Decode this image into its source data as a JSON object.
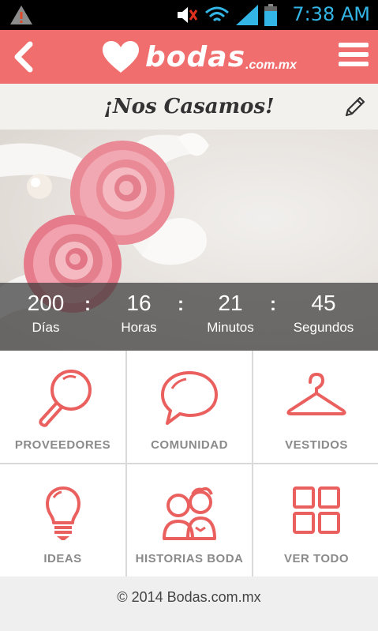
{
  "status": {
    "time": "7:38 AM"
  },
  "header": {
    "brand_name": "bodas",
    "brand_domain": ".com.mx"
  },
  "titlebar": {
    "title": "¡Nos Casamos!"
  },
  "countdown": [
    {
      "value": "200",
      "label": "Días"
    },
    {
      "value": "16",
      "label": "Horas"
    },
    {
      "value": "21",
      "label": "Minutos"
    },
    {
      "value": "45",
      "label": "Segundos"
    }
  ],
  "separator": ":",
  "tiles": [
    {
      "label": "PROVEEDORES",
      "icon": "search-icon"
    },
    {
      "label": "COMUNIDAD",
      "icon": "chat-bubble-icon"
    },
    {
      "label": "VESTIDOS",
      "icon": "hanger-icon"
    },
    {
      "label": "IDEAS",
      "icon": "lightbulb-icon"
    },
    {
      "label": "HISTORIAS BODA",
      "icon": "couple-icon"
    },
    {
      "label": "VER TODO",
      "icon": "grid-icon"
    }
  ],
  "footer": {
    "copyright": "© 2014 Bodas.com.mx"
  },
  "colors": {
    "brand": "#f06e6e",
    "icon": "#e9605f",
    "label": "#8a8a8a"
  }
}
